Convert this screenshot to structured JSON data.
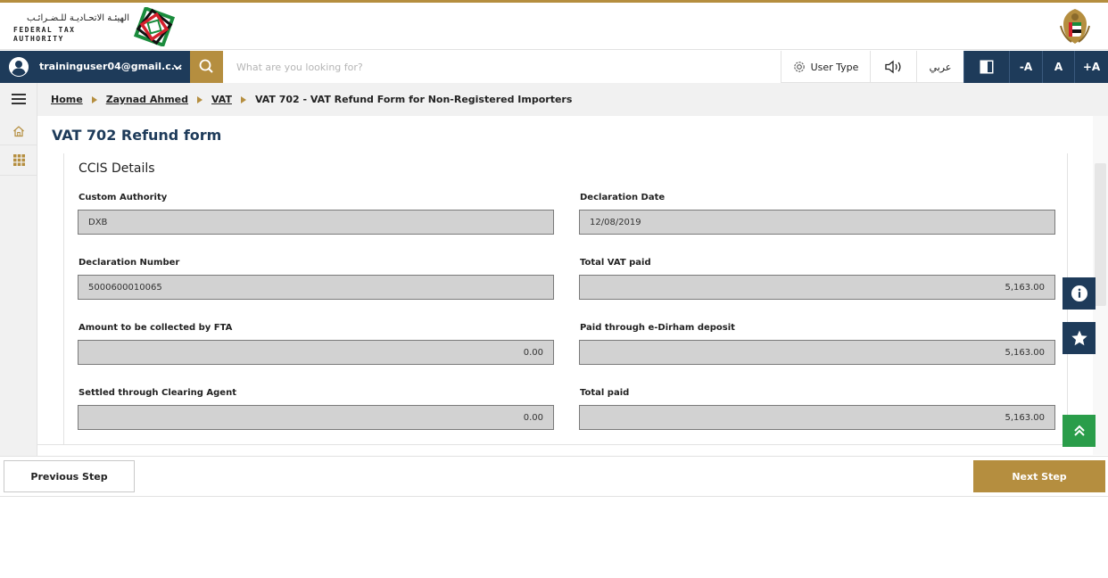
{
  "header": {
    "logo_ar": "الهيئـة الاتحـاديـة للـضـرائـب",
    "logo_en": "FEDERAL TAX AUTHORITY"
  },
  "toolbar": {
    "user_email": "traininguser04@gmail.c...",
    "search_placeholder": "What are you looking for?",
    "user_type_label": "User Type",
    "arabic_label": "عربي",
    "font_decrease": "-A",
    "font_normal": "A",
    "font_increase": "+A"
  },
  "breadcrumb": {
    "items": [
      "Home",
      "Zaynad Ahmed",
      "VAT"
    ],
    "current": "VAT 702 - VAT Refund Form for Non-Registered Importers"
  },
  "page": {
    "title": "VAT 702 Refund form",
    "section_title": "CCIS Details"
  },
  "form": {
    "custom_authority": {
      "label": "Custom Authority",
      "value": "DXB"
    },
    "declaration_date": {
      "label": "Declaration Date",
      "value": "12/08/2019"
    },
    "declaration_number": {
      "label": "Declaration Number",
      "value": "5000600010065"
    },
    "total_vat_paid": {
      "label": "Total VAT paid",
      "value": "5,163.00"
    },
    "amount_collected": {
      "label": "Amount to be collected by FTA",
      "value": "0.00"
    },
    "edirham_paid": {
      "label": "Paid through e-Dirham deposit",
      "value": "5,163.00"
    },
    "clearing_agent": {
      "label": "Settled through Clearing Agent",
      "value": "0.00"
    },
    "total_paid": {
      "label": "Total paid",
      "value": "5,163.00"
    }
  },
  "footer": {
    "previous_label": "Previous Step",
    "next_label": "Next Step"
  },
  "colors": {
    "navy": "#1e3b5a",
    "gold": "#b58e3f",
    "green": "#2a9d4a",
    "field_bg": "#d2d2d2"
  }
}
